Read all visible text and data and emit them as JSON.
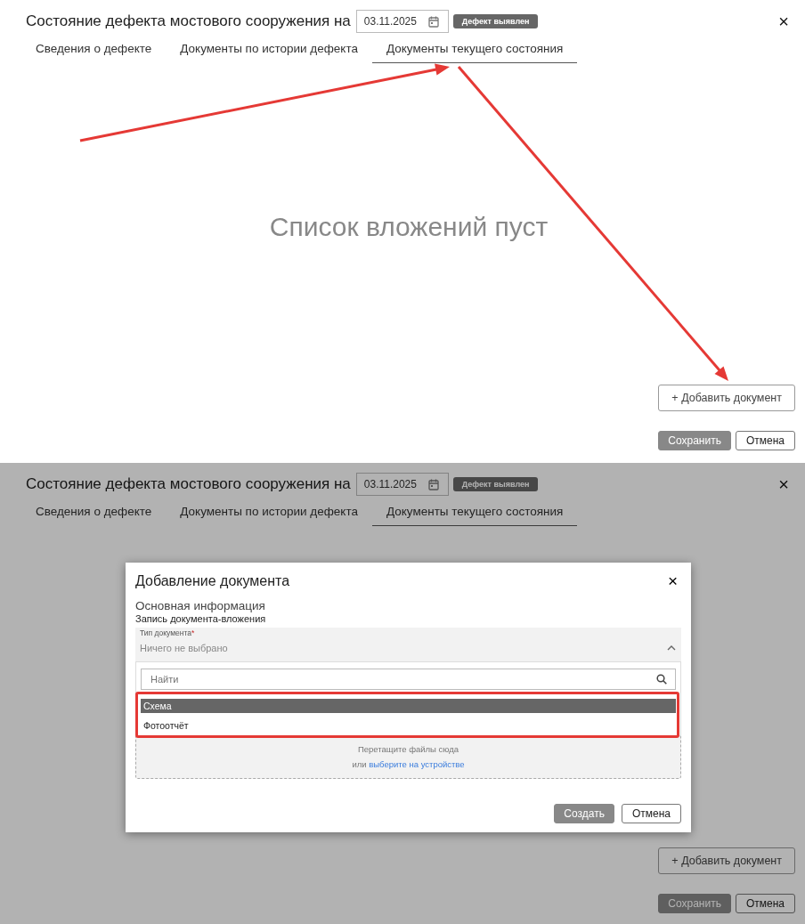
{
  "screens": [
    {
      "title": "Состояние дефекта мостового сооружения на",
      "date": "03.11.2025",
      "status": "Дефект выявлен",
      "close": "×",
      "tabs": [
        {
          "label": "Сведения о дефекте",
          "selected": false
        },
        {
          "label": "Документы по истории дефекта",
          "selected": false
        },
        {
          "label": "Документы текущего состояния",
          "selected": true
        }
      ],
      "empty_message": "Список вложений пуст",
      "add_button": "+ Добавить документ",
      "save_button": "Сохранить",
      "cancel_button": "Отмена"
    },
    {
      "title": "Состояние дефекта мостового сооружения на",
      "date": "03.11.2025",
      "status": "Дефект выявлен",
      "close": "×",
      "tabs": [
        {
          "label": "Сведения о дефекте",
          "selected": false
        },
        {
          "label": "Документы по истории дефекта",
          "selected": false
        },
        {
          "label": "Документы текущего состояния",
          "selected": true
        }
      ],
      "add_button": "+ Добавить документ",
      "save_button": "Сохранить",
      "cancel_button": "Отмена",
      "dialog": {
        "title": "Добавление документа",
        "close": "×",
        "section": "Основная информация",
        "subsection": "Запись документа-вложения",
        "field": {
          "label": "Тип документа",
          "required_mark": "*",
          "placeholder": "Ничего не выбрано",
          "expanded": true
        },
        "search": {
          "placeholder": "Найти"
        },
        "options": [
          {
            "label": "Схема",
            "selected": true
          },
          {
            "label": "Фотоотчёт",
            "selected": false
          }
        ],
        "dropzone": {
          "text": "Перетащите файлы сюда",
          "prefix": "или",
          "link": "выберите на устройстве"
        },
        "create_button": "Создать",
        "cancel_button": "Отмена"
      }
    }
  ]
}
